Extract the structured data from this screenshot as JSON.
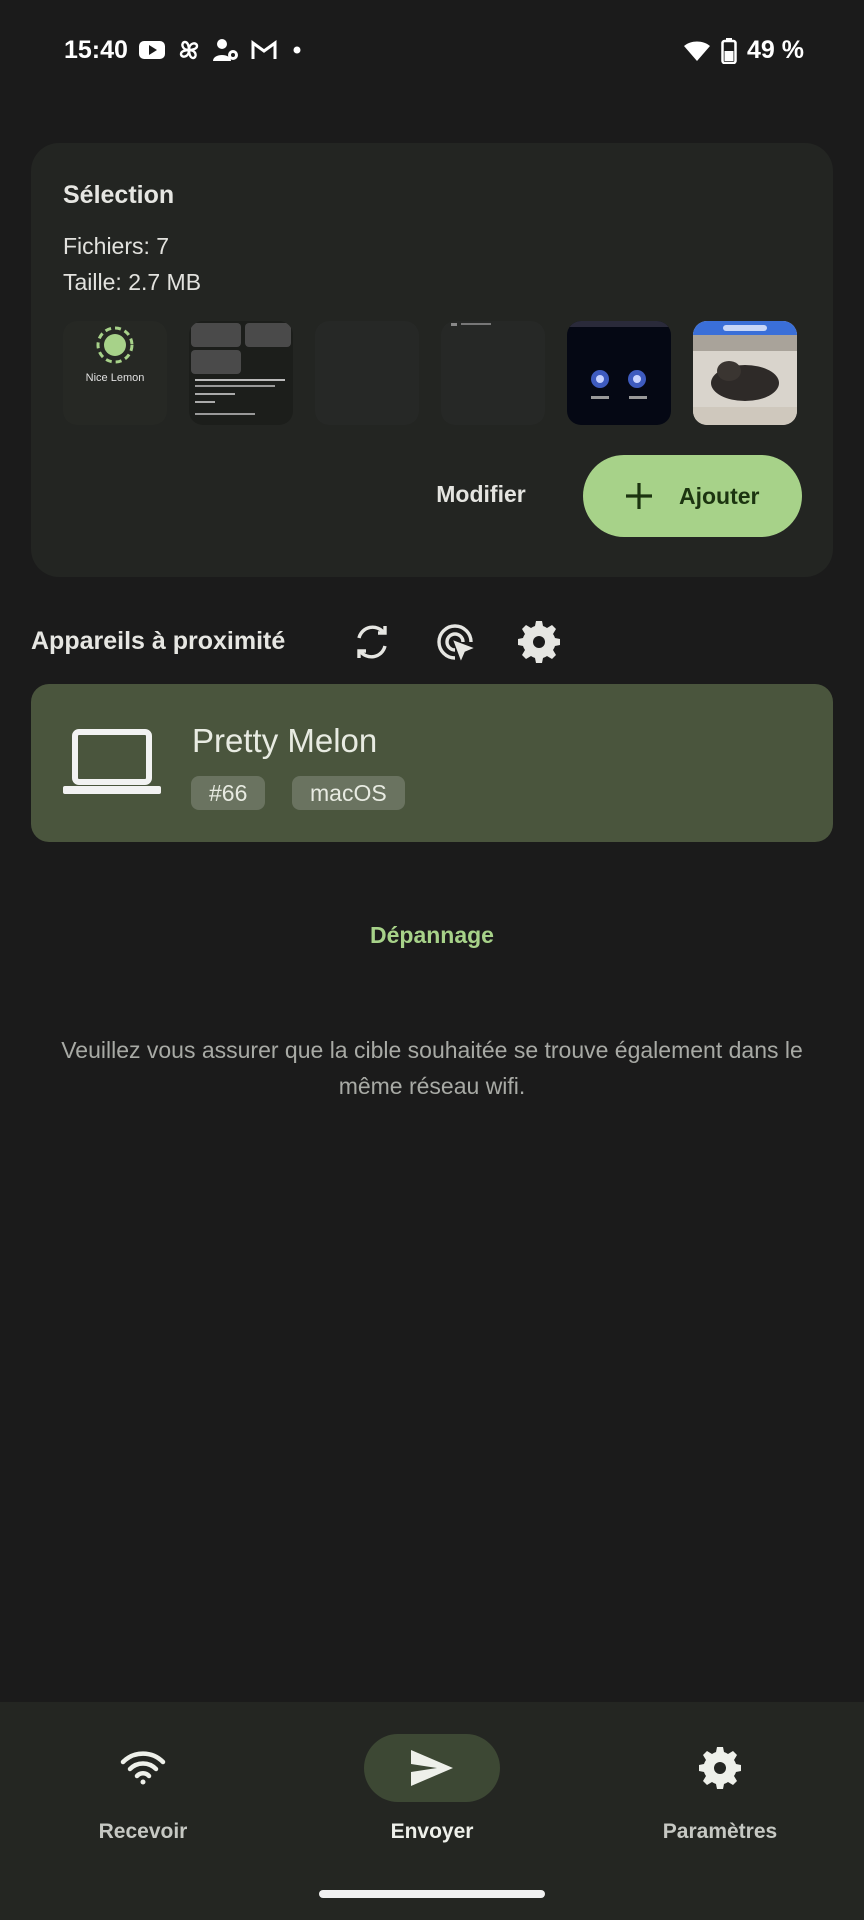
{
  "status_bar": {
    "time": "15:40",
    "battery": "49 %",
    "icons": [
      "youtube-icon",
      "pinwheel-icon",
      "person-icon",
      "gmail-icon",
      "dot-icon",
      "wifi-icon",
      "battery-icon"
    ]
  },
  "selection": {
    "title": "Sélection",
    "files": "Fichiers: 7",
    "size": "Taille: 2.7 MB",
    "thumbnails": [
      "thumb-1",
      "thumb-2",
      "thumb-3",
      "thumb-4",
      "thumb-5",
      "thumb-6"
    ],
    "thumb1_text": "Nice Lemon",
    "modify_label": "Modifier",
    "add_label": "Ajouter"
  },
  "nearby": {
    "title": "Appareils à proximité",
    "actions": [
      "refresh-icon",
      "target-cursor-icon",
      "gear-icon"
    ]
  },
  "device": {
    "name": "Pretty Melon",
    "id_badge": "#66",
    "os_badge": "macOS"
  },
  "troubleshoot_label": "Dépannage",
  "hint": "Veuillez vous assurer que la cible souhaitée se trouve également dans le même réseau wifi.",
  "nav": {
    "receive": "Recevoir",
    "send": "Envoyer",
    "settings": "Paramètres",
    "active": "send"
  },
  "colors": {
    "background": "#1b1b1b",
    "card": "#232522",
    "accent": "#a7d289",
    "device_card": "#4a553d",
    "nav_active": "#3d4834"
  }
}
